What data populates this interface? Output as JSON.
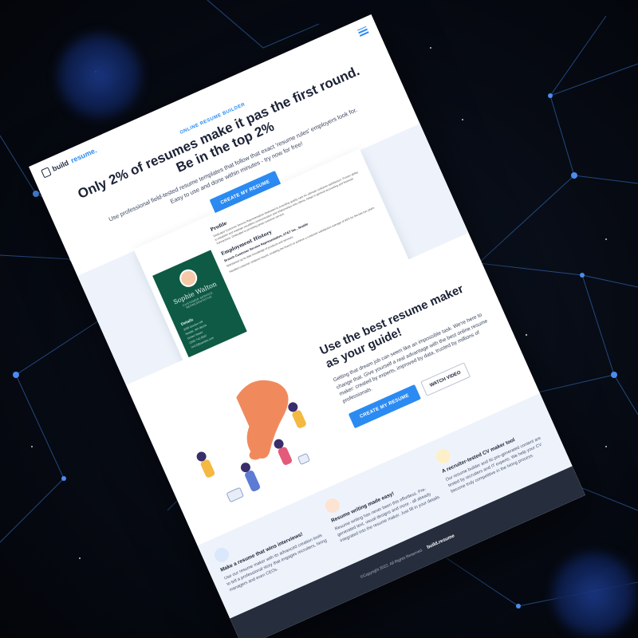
{
  "header": {
    "logo_text": "build",
    "logo_accent": "resume.",
    "menu_icon": "hamburger-icon"
  },
  "hero": {
    "kicker": "ONLINE RESUME BUILDER",
    "title": "Only 2% of resumes make it pas the first round. Be in the top 2%",
    "subtitle": "Use professional field-tested resume templates that follow that exact 'resume rules' employers look for. Easy to use and done within minutes - try now for free!",
    "cta_label": "CREATE MY RESUME"
  },
  "resume_preview": {
    "name": "Sophie Walton",
    "role": "CUSTOMER SERVICE REPRESENTATIVE",
    "details_heading": "Details",
    "details_lines": [
      "3289 Gordon Hill",
      "Seattle, WA 98104",
      "United States",
      "(206) 742-5587",
      "hw12@yandex.com"
    ],
    "profile_heading": "Profile",
    "profile_text": "Dedicated Customer Service Representative dedicated to providing quality care for ultimate customer satisfaction. Proven ability to establish and maintain excellent communication and relationships with clients. Adept in general accounting and financial transactions. Dedicated to providing great customer service.",
    "employment_heading": "Employment History",
    "job_title": "Branch Customer Service Representative, AT&T Inc., Seattle",
    "job_bullets": [
      "Maintained up-to-date knowledge of products and services.",
      "Handled customer relations issues, enabling the branch to achieve a customer satisfaction average of 90% for the last two years."
    ]
  },
  "guide": {
    "title": "Use the best resume maker as your guide!",
    "description": "Getting that dream job can seem like an impossible task. We're here to change that. Give yourself a real advantage with the best online resume maker: created by experts, improved by data, trusted by millions of professionals.",
    "cta_primary": "CREATE MY RESUME",
    "cta_secondary": "WATCH VIDEO"
  },
  "features": [
    {
      "icon": "target-icon",
      "title": "Make a resume that wins interviews!",
      "desc": "Use our resume maker with its advanced creation tools to tell a professional story that engages recruiters, hiring managers and even CEOs."
    },
    {
      "icon": "pen-icon",
      "title": "Resume writing made easy!",
      "desc": "Resume writing has never been this effortless. Pre-generated text, visual designs and more - all already integrated into the resume maker. Just fill in your details."
    },
    {
      "icon": "rocket-icon",
      "title": "A recruiter-tested CV maker tool",
      "desc": "Our resume builder and its pre-generated content are tested by recruiters and IT experts. We help your CV become truly competitive in the hiring process."
    }
  ],
  "footer": {
    "copyright": "©Copyright 2022. All Rights Reserved.",
    "brand": "build.resume"
  },
  "colors": {
    "accent": "#2b8bf2",
    "dark_navy": "#1b2236",
    "resume_green": "#0e5a44",
    "footer_bg": "#262d3d",
    "section_bg": "#eef3fb"
  }
}
